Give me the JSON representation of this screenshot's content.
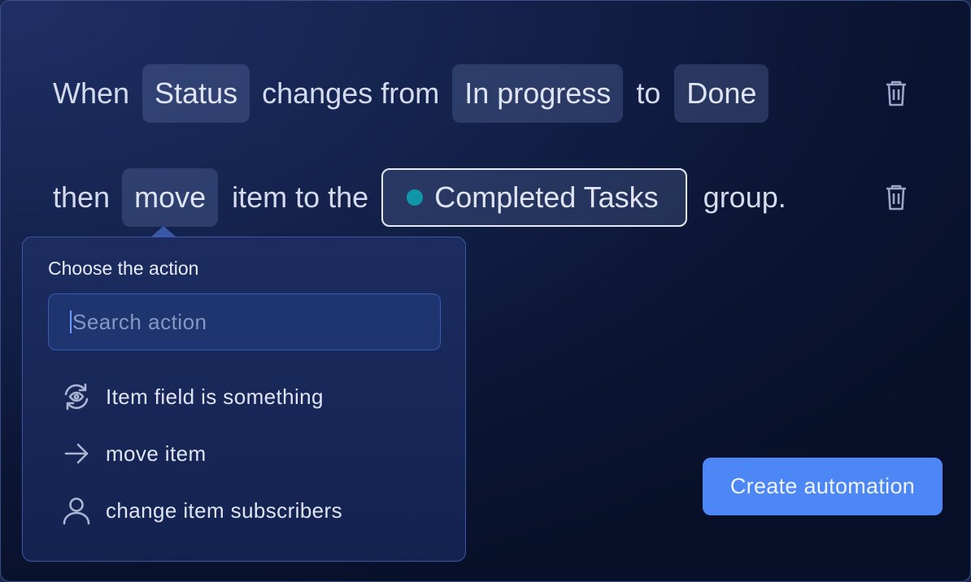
{
  "rule": {
    "line1": {
      "when_text": "When",
      "field_chip": "Status",
      "changes_text": "changes from",
      "from_chip": "In progress",
      "to_text": "to",
      "to_chip": "Done"
    },
    "line2": {
      "then_text": "then",
      "action_chip": "move",
      "middle_text": "item to the",
      "group_chip": "Completed Tasks",
      "group_color": "#0f97a8",
      "end_text": "group."
    }
  },
  "popover": {
    "title": "Choose the action",
    "search_placeholder": "Search action",
    "options": [
      {
        "icon": "refresh-eye-icon",
        "label": "Item field is something"
      },
      {
        "icon": "arrow-right-icon",
        "label": "move item"
      },
      {
        "icon": "user-icon",
        "label": "change item subscribers"
      }
    ]
  },
  "actions": {
    "create_label": "Create automation"
  },
  "colors": {
    "accent": "#4d87f5",
    "background": "#0b1533"
  }
}
